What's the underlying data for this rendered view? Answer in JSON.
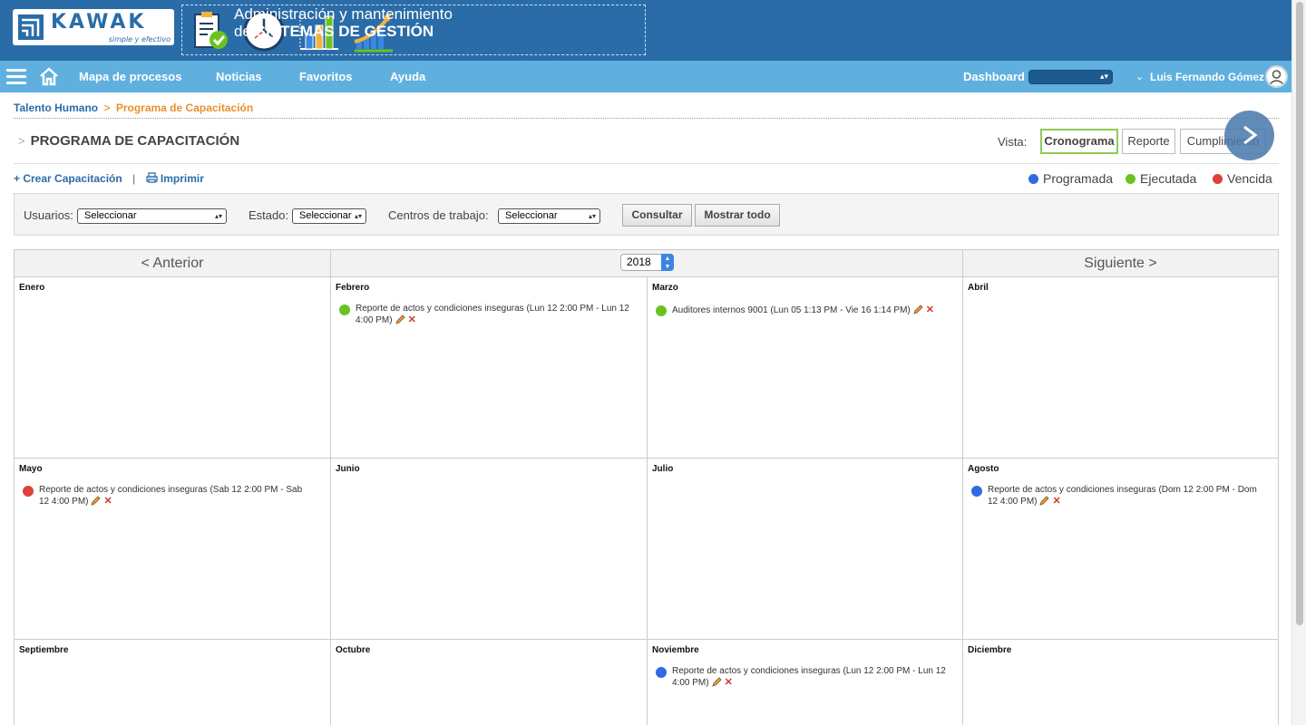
{
  "brand": {
    "logo_text": "KAWAK",
    "logo_tagline": "simple y efectivo",
    "banner_line1": "Administración y mantenimiento",
    "banner_line2_prefix": "de",
    "banner_line2_bold": "SISTEMAS DE GESTIÓN"
  },
  "nav": {
    "items": [
      {
        "label": "Mapa de procesos"
      },
      {
        "label": "Noticias"
      },
      {
        "label": "Favoritos"
      },
      {
        "label": "Ayuda"
      }
    ],
    "dashboard_label": "Dashboard",
    "dashboard_value": "",
    "user_name": "Luis Fernando Gómez"
  },
  "breadcrumb": {
    "parent": "Talento Humano",
    "separator": ">",
    "current": "Programa de Capacitación"
  },
  "page": {
    "title": "PROGRAMA DE CAPACITACIÓN",
    "title_chevron": ">",
    "vista_label": "Vista:",
    "views": [
      {
        "label": "Cronograma",
        "active": true
      },
      {
        "label": "Reporte",
        "active": false
      },
      {
        "label": "Cumplimiento",
        "active": false
      }
    ]
  },
  "actions": {
    "create_label": "+ Crear Capacitación",
    "separator": "|",
    "print_label": "Imprimir"
  },
  "legend": [
    {
      "label": "Programada",
      "color": "#2f6be0"
    },
    {
      "label": "Ejecutada",
      "color": "#6ac21e"
    },
    {
      "label": "Vencida",
      "color": "#e0403a"
    }
  ],
  "filters": {
    "usuarios_label": "Usuarios:",
    "usuarios_value": "Seleccionar",
    "estado_label": "Estado:",
    "estado_value": "Seleccionar",
    "centros_label": "Centros de trabajo:",
    "centros_value": "Seleccionar",
    "consultar_label": "Consultar",
    "mostrar_label": "Mostrar todo"
  },
  "calendar": {
    "prev_label": "<  Anterior",
    "next_label": "Siguiente  >",
    "year": "2018",
    "months": [
      {
        "name": "Enero",
        "events": []
      },
      {
        "name": "Febrero",
        "events": [
          {
            "text": "Reporte de actos y condiciones inseguras (Lun 12 2:00 PM - Lun 12 4:00 PM)",
            "status": "Ejecutada"
          }
        ]
      },
      {
        "name": "Marzo",
        "events": [
          {
            "text": "Auditores internos 9001 (Lun 05 1:13 PM - Vie 16 1:14 PM)",
            "status": "Ejecutada"
          }
        ]
      },
      {
        "name": "Abril",
        "events": []
      },
      {
        "name": "Mayo",
        "events": [
          {
            "text": "Reporte de actos y condiciones inseguras (Sab 12 2:00 PM - Sab 12 4:00 PM)",
            "status": "Vencida"
          }
        ]
      },
      {
        "name": "Junio",
        "events": []
      },
      {
        "name": "Julio",
        "events": []
      },
      {
        "name": "Agosto",
        "events": [
          {
            "text": "Reporte de actos y condiciones inseguras (Dom 12 2:00 PM - Dom 12 4:00 PM)",
            "status": "Programada"
          }
        ]
      },
      {
        "name": "Septiembre",
        "events": []
      },
      {
        "name": "Octubre",
        "events": []
      },
      {
        "name": "Noviembre",
        "events": [
          {
            "text": "Reporte de actos y condiciones inseguras (Lun 12 2:00 PM - Lun 12 4:00 PM)",
            "status": "Programada"
          }
        ]
      },
      {
        "name": "Diciembre",
        "events": []
      }
    ]
  },
  "colors": {
    "banner": "#2a6ca8",
    "nav": "#5fb0de",
    "accent_orange": "#e8902c",
    "programada": "#2f6be0",
    "ejecutada": "#6ac21e",
    "vencida": "#e0403a"
  }
}
